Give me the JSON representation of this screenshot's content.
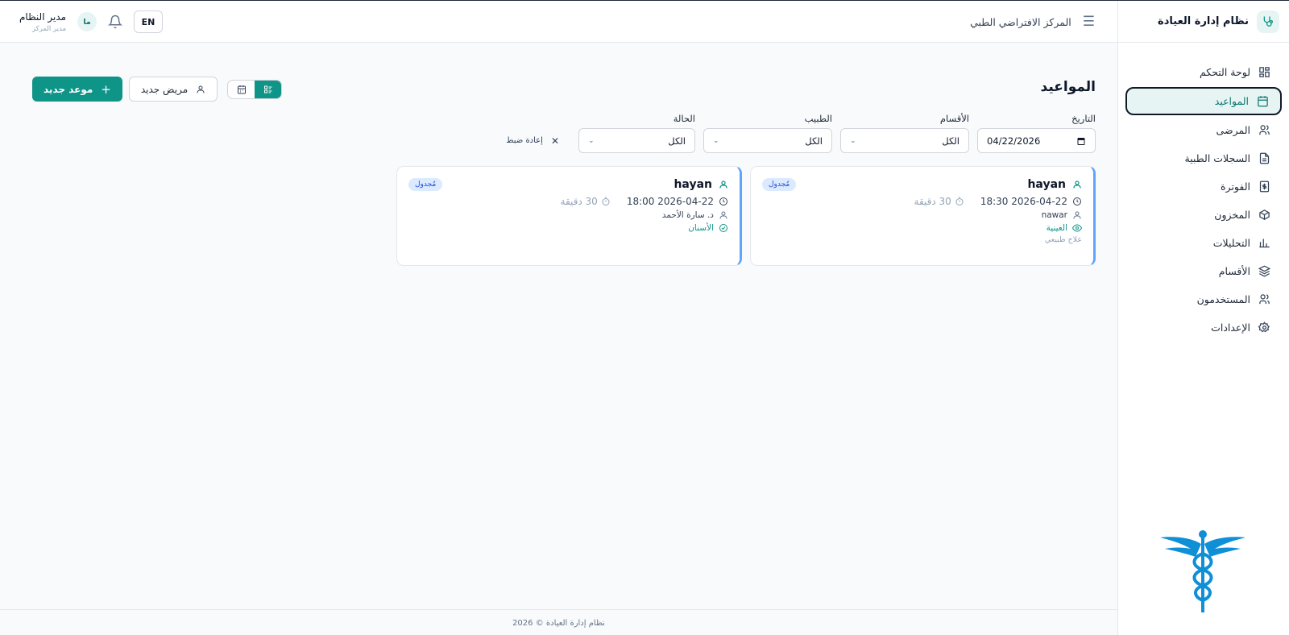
{
  "brand": {
    "title": "نظام إدارة العيادة"
  },
  "sidebar": {
    "items": [
      {
        "label": "لوحة التحكم",
        "icon": "dashboard-icon"
      },
      {
        "label": "المواعيد",
        "icon": "calendar-icon",
        "active": true
      },
      {
        "label": "المرضى",
        "icon": "users-icon"
      },
      {
        "label": "السجلات الطبية",
        "icon": "file-text-icon"
      },
      {
        "label": "الفوترة",
        "icon": "dollar-icon"
      },
      {
        "label": "المخزون",
        "icon": "package-icon"
      },
      {
        "label": "التحليلات",
        "icon": "bar-chart-icon"
      },
      {
        "label": "الأقسام",
        "icon": "layers-icon"
      },
      {
        "label": "المستخدمون",
        "icon": "users-icon"
      },
      {
        "label": "الإعدادات",
        "icon": "settings-icon"
      }
    ]
  },
  "header": {
    "center_name": "المركز الافتراضي الطبي",
    "lang": "EN",
    "user_name": "مدير النظام",
    "user_role": "مدير المركز",
    "avatar_initials": "ما"
  },
  "page": {
    "title": "المواعيد"
  },
  "toolbar": {
    "new_appointment": "موعد جديد",
    "new_patient": "مريض جديد"
  },
  "filters": {
    "date_label": "التاريخ",
    "date_value": "04/22/2026",
    "department_label": "الأقسام",
    "department_value": "الكل",
    "doctor_label": "الطبيب",
    "doctor_value": "الكل",
    "status_label": "الحالة",
    "status_value": "الكل",
    "reset": "إعادة ضبط"
  },
  "appointments": [
    {
      "patient": "hayan",
      "status": "مُجدول",
      "datetime": "2026-04-22 18:30",
      "duration": "30 دقيقة",
      "doctor": "nawar",
      "department": "العينية",
      "note": "علاج طبيعي"
    },
    {
      "patient": "hayan",
      "status": "مُجدول",
      "datetime": "2026-04-22 18:00",
      "duration": "30 دقيقة",
      "doctor": "د. سارة الأحمد",
      "department": "الأسنان"
    }
  ],
  "footer": {
    "text": "نظام إدارة العيادة © 2026"
  },
  "colors": {
    "primary": "#0f9488",
    "active_bg": "#e6f5f3",
    "card_accent": "#60a5fa"
  }
}
